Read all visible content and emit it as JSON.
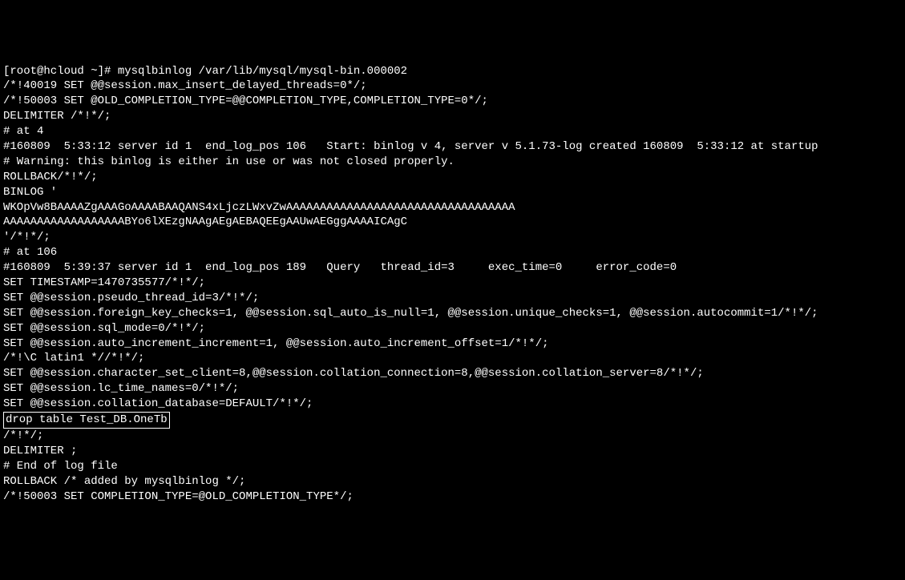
{
  "terminal": {
    "lines": [
      "[root@hcloud ~]# mysqlbinlog /var/lib/mysql/mysql-bin.000002",
      "/*!40019 SET @@session.max_insert_delayed_threads=0*/;",
      "/*!50003 SET @OLD_COMPLETION_TYPE=@@COMPLETION_TYPE,COMPLETION_TYPE=0*/;",
      "DELIMITER /*!*/;",
      "# at 4",
      "#160809  5:33:12 server id 1  end_log_pos 106   Start: binlog v 4, server v 5.1.73-log created 160809  5:33:12 at startup",
      "# Warning: this binlog is either in use or was not closed properly.",
      "ROLLBACK/*!*/;",
      "BINLOG '",
      "WKOpVw8BAAAAZgAAAGoAAAABAAQANS4xLjczLWxvZwAAAAAAAAAAAAAAAAAAAAAAAAAAAAAAAAAA",
      "AAAAAAAAAAAAAAAAAABYo6lXEzgNAAgAEgAEBAQEEgAAUwAEGggAAAAICAgC",
      "'/*!*/;",
      "# at 106",
      "#160809  5:39:37 server id 1  end_log_pos 189   Query   thread_id=3     exec_time=0     error_code=0",
      "SET TIMESTAMP=1470735577/*!*/;",
      "SET @@session.pseudo_thread_id=3/*!*/;",
      "SET @@session.foreign_key_checks=1, @@session.sql_auto_is_null=1, @@session.unique_checks=1, @@session.autocommit=1/*!*/;",
      "SET @@session.sql_mode=0/*!*/;",
      "SET @@session.auto_increment_increment=1, @@session.auto_increment_offset=1/*!*/;",
      "/*!\\C latin1 *//*!*/;",
      "SET @@session.character_set_client=8,@@session.collation_connection=8,@@session.collation_server=8/*!*/;",
      "SET @@session.lc_time_names=0/*!*/;",
      "SET @@session.collation_database=DEFAULT/*!*/;"
    ],
    "highlighted_line": "drop table Test_DB.OneTb",
    "lines_after": [
      "/*!*/;",
      "DELIMITER ;",
      "# End of log file",
      "ROLLBACK /* added by mysqlbinlog */;",
      "/*!50003 SET COMPLETION_TYPE=@OLD_COMPLETION_TYPE*/;"
    ]
  }
}
